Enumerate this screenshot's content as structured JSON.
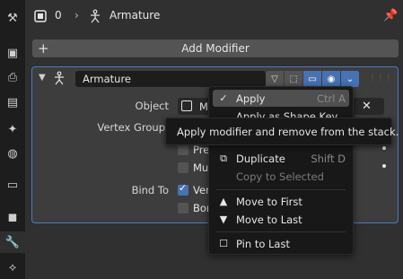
{
  "toolstrip": {
    "icons": [
      "tool-icon",
      "render-icon",
      "output-icon",
      "view-layer-icon",
      "scene-icon",
      "world-icon",
      "collection-icon",
      "object-icon",
      "modifier-icon",
      "particles-icon"
    ]
  },
  "header": {
    "object_count": "0",
    "context_name": "Armature"
  },
  "add_modifier": {
    "label": "Add Modifier"
  },
  "modifier": {
    "name": "Armature",
    "object_label": "Object",
    "object_value": "M",
    "vertex_group_label": "Vertex Group",
    "bind_to_label": "Bind To",
    "checkbox_pre": "Pre",
    "checkbox_mu": "Mu",
    "checkbox_ver": "Ver",
    "checkbox_bor": "Bor"
  },
  "menu": {
    "items": [
      {
        "label": "Apply",
        "shortcut": "Ctrl A"
      },
      {
        "label": "Apply as Shape Key",
        "shortcut": ""
      },
      {
        "label": "Duplicate",
        "shortcut": "Shift D"
      },
      {
        "label": "Copy to Selected",
        "shortcut": ""
      },
      {
        "label": "Move to First",
        "shortcut": ""
      },
      {
        "label": "Move to Last",
        "shortcut": ""
      },
      {
        "label": "Pin to Last",
        "shortcut": ""
      }
    ]
  },
  "tooltip": {
    "text": "Apply modifier and remove from the stack."
  },
  "colors": {
    "accent": "#4772b3",
    "panel_outline": "#4a7bc4",
    "active_tab": "#5aa7ff"
  }
}
